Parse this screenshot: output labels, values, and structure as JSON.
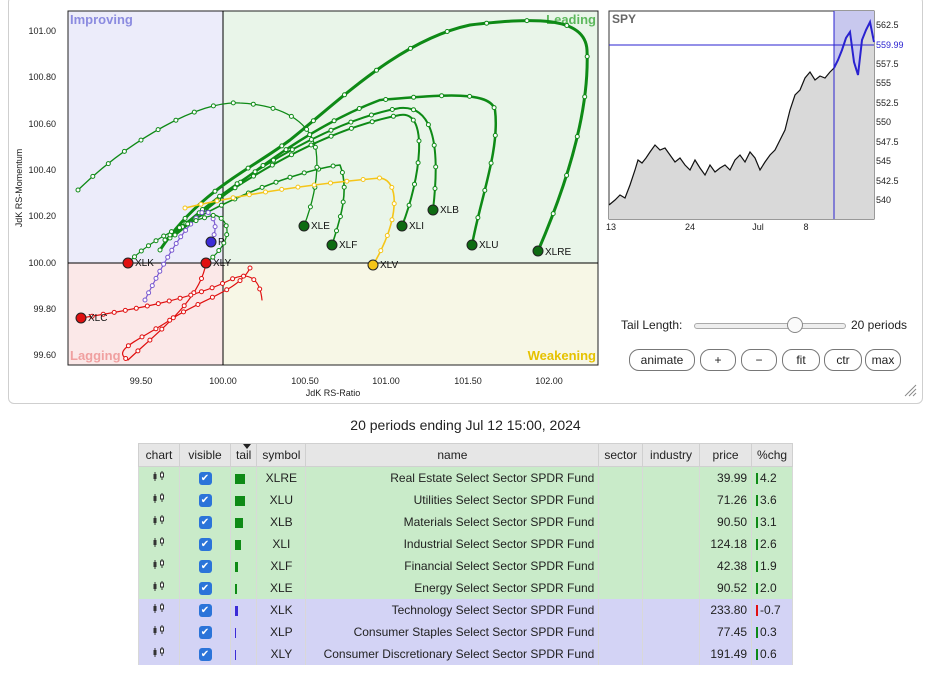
{
  "rrg": {
    "quadrants": {
      "improving": "Improving",
      "leading": "Leading",
      "weakening": "Weakening",
      "lagging": "Lagging"
    },
    "x_axis_label": "JdK RS-Ratio",
    "y_axis_label": "JdK RS-Momentum",
    "x_ticks": [
      "99.50",
      "100.00",
      "100.50",
      "101.00",
      "101.50",
      "102.00"
    ],
    "y_ticks": [
      "101.00",
      "100.80",
      "100.60",
      "100.40",
      "100.20",
      "100.00",
      "99.80",
      "99.60"
    ],
    "labels": {
      "XLRE": "XLRE",
      "XLU": "XLU",
      "XLB": "XLB",
      "XLI": "XLI",
      "XLF": "XLF",
      "XLE": "XLE",
      "XLV": "XLV",
      "XLK": "XLK",
      "XLC": "XLC",
      "XLY": "XLY",
      "XLP": "P"
    },
    "colors": {
      "green": "#0e8a16",
      "yellow": "#f5c518",
      "red": "#e01010",
      "blue": "#3b2bd6",
      "purple": "#7a5ad0"
    }
  },
  "spy": {
    "title": "SPY",
    "current": "559.99",
    "y_ticks": [
      "562.5",
      "560",
      "557.5",
      "555",
      "552.5",
      "550",
      "547.5",
      "545",
      "542.5",
      "540"
    ],
    "x_ticks": [
      "13",
      "24",
      "Jul",
      "8"
    ]
  },
  "controls": {
    "tail_length_label": "Tail Length:",
    "tail_length_value": "20 periods",
    "animate": "animate",
    "plus": "+",
    "minus": "−",
    "fit": "fit",
    "ctr": "ctr",
    "max": "max"
  },
  "subtitle": "20 periods ending Jul 12 15:00, 2024",
  "table": {
    "headers": {
      "chart": "chart",
      "visible": "visible",
      "tail": "tail",
      "symbol": "symbol",
      "name": "name",
      "sector": "sector",
      "industry": "industry",
      "price": "price",
      "chg": "%chg"
    },
    "rows": [
      {
        "symbol": "XLRE",
        "name": "Real Estate Select Sector SPDR Fund",
        "price": "39.99",
        "chg": "4.2"
      },
      {
        "symbol": "XLU",
        "name": "Utilities Select Sector SPDR Fund",
        "price": "71.26",
        "chg": "3.6"
      },
      {
        "symbol": "XLB",
        "name": "Materials Select Sector SPDR Fund",
        "price": "90.50",
        "chg": "3.1"
      },
      {
        "symbol": "XLI",
        "name": "Industrial Select Sector SPDR Fund",
        "price": "124.18",
        "chg": "2.6"
      },
      {
        "symbol": "XLF",
        "name": "Financial Select Sector SPDR Fund",
        "price": "42.38",
        "chg": "1.9"
      },
      {
        "symbol": "XLE",
        "name": "Energy Select Sector SPDR Fund",
        "price": "90.52",
        "chg": "2.0"
      },
      {
        "symbol": "XLK",
        "name": "Technology Select Sector SPDR Fund",
        "price": "233.80",
        "chg": "-0.7"
      },
      {
        "symbol": "XLP",
        "name": "Consumer Staples Select Sector SPDR Fund",
        "price": "77.45",
        "chg": "0.3"
      },
      {
        "symbol": "XLY",
        "name": "Consumer Discretionary Select Sector SPDR Fund",
        "price": "191.49",
        "chg": "0.6"
      }
    ],
    "icons": {
      "chart": "candlestick-icon",
      "visible": "checkbox-checked-icon",
      "check_glyph": "✔",
      "sort": "sort-desc-icon"
    }
  }
}
